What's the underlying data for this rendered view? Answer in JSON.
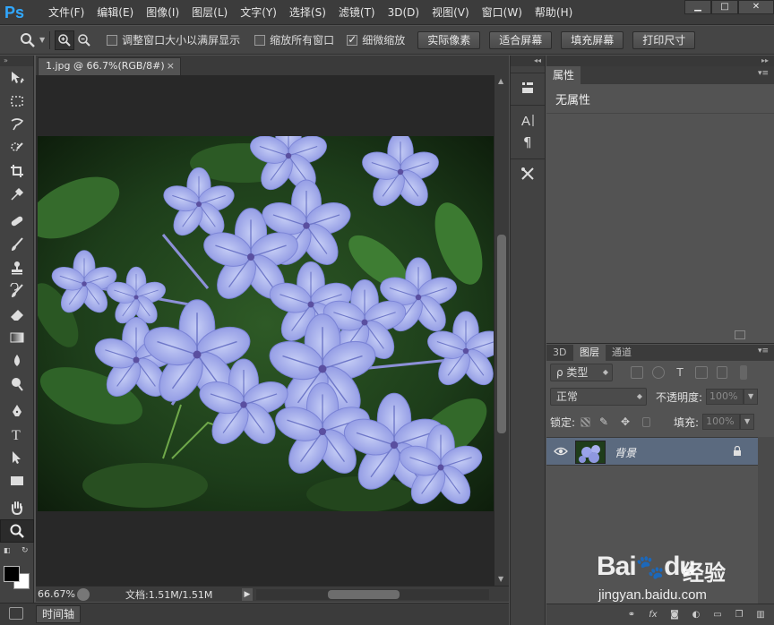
{
  "app": {
    "logo": "Ps"
  },
  "menu": [
    "文件(F)",
    "编辑(E)",
    "图像(I)",
    "图层(L)",
    "文字(Y)",
    "选择(S)",
    "滤镜(T)",
    "3D(D)",
    "视图(V)",
    "窗口(W)",
    "帮助(H)"
  ],
  "window_controls": {
    "minimize": "▁",
    "maximize": "□",
    "close": "✕"
  },
  "options": {
    "resize_windows": {
      "label": "调整窗口大小以满屏显示",
      "checked": false
    },
    "zoom_all": {
      "label": "缩放所有窗口",
      "checked": false
    },
    "scrubby_zoom": {
      "label": "细微缩放",
      "checked": true
    },
    "buttons": [
      "实际像素",
      "适合屏幕",
      "填充屏幕",
      "打印尺寸"
    ]
  },
  "document": {
    "tab_title": "1.jpg @ 66.7%(RGB/8#)",
    "tab_close": "×",
    "zoom": "66.67%",
    "size": "文档:1.51M/1.51M"
  },
  "timeline": {
    "label": "时间轴"
  },
  "properties_panel": {
    "tab": "属性",
    "content": "无属性"
  },
  "layers_panel": {
    "tabs": [
      "3D",
      "图层",
      "通道"
    ],
    "active_tab": "图层",
    "filter_label": "ρ 类型",
    "blend_mode": "正常",
    "opacity_label": "不透明度:",
    "opacity_value": "100%",
    "lock_label": "锁定:",
    "fill_label": "填充:",
    "fill_value": "100%",
    "layers": [
      {
        "name": "背景",
        "locked": true,
        "visible": true
      }
    ],
    "footer_icons": [
      "link-icon",
      "fx-icon",
      "mask-icon",
      "adjustment-icon",
      "group-icon",
      "new-layer-icon",
      "delete-icon"
    ]
  },
  "watermark": {
    "brand": "Bai",
    "brand2": "du",
    "cn": "经验",
    "url": "jingyan.baidu.com"
  },
  "colors": {
    "accent": "#31a8ff",
    "selected_layer": "#5b6a7f",
    "panel": "#535353",
    "chrome": "#3c3c3c"
  }
}
